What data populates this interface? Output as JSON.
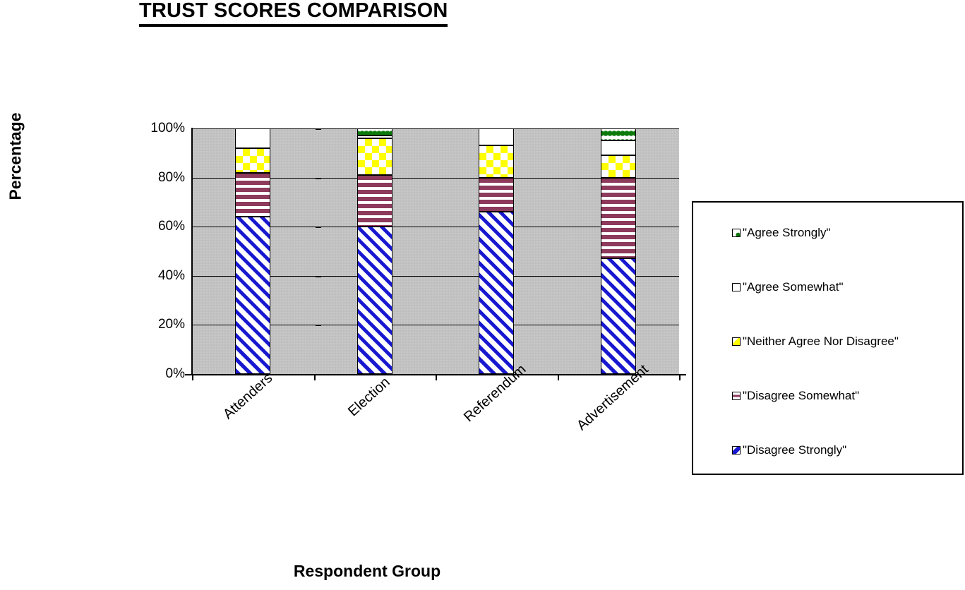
{
  "chart_data": {
    "type": "bar",
    "subtype": "stacked-100-percent",
    "title": "TRUST SCORES COMPARISON",
    "xlabel": "Respondent Group",
    "ylabel": "Percentage",
    "categories": [
      "Attenders",
      "Election",
      "Referendum",
      "Advertisement"
    ],
    "ylim": [
      0,
      100
    ],
    "ytick_labels": [
      "100%",
      "80%",
      "60%",
      "40%",
      "20%",
      "0%"
    ],
    "ytick_values": [
      100,
      80,
      60,
      40,
      20,
      0
    ],
    "grid": true,
    "legend_position": "right",
    "series": [
      {
        "name": "\"Disagree Strongly\"",
        "pattern": "blue-diagonal-stripes",
        "color": "#1818d0",
        "values": [
          64,
          60,
          66,
          47
        ]
      },
      {
        "name": "\"Disagree Somewhat\"",
        "pattern": "maroon-horizontal-lines",
        "color": "#8d3a5c",
        "values": [
          18,
          21,
          14,
          33
        ]
      },
      {
        "name": "\"Neither Agree Nor Disagree\"",
        "pattern": "yellow-checkerboard",
        "color": "#ffff00",
        "values": [
          10,
          15,
          13,
          9
        ]
      },
      {
        "name": "\"Agree Somewhat\"",
        "pattern": "white-solid",
        "color": "#ffffff",
        "values": [
          8,
          1,
          7,
          6
        ]
      },
      {
        "name": "\"Agree Strongly\"",
        "pattern": "green-diamonds",
        "color": "#0b7a0b",
        "values": [
          0,
          3,
          0,
          5
        ]
      }
    ]
  },
  "legend": {
    "items": [
      {
        "label": "\"Agree Strongly\"",
        "swatch": "green-diamond-swatch"
      },
      {
        "label": "\"Agree Somewhat\"",
        "swatch": "white-swatch"
      },
      {
        "label": "\"Neither Agree Nor Disagree\"",
        "swatch": "yellow-checker-swatch"
      },
      {
        "label": "\"Disagree Somewhat\"",
        "swatch": "maroon-lines-swatch"
      },
      {
        "label": "\"Disagree Strongly\"",
        "swatch": "blue-diagonal-swatch"
      }
    ]
  },
  "colors": {
    "plot_background": "#c0c0c0",
    "page_background": "#ffffff",
    "axis": "#000000"
  }
}
